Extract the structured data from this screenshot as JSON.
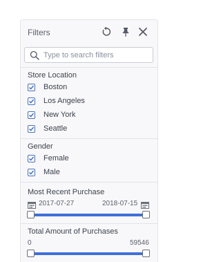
{
  "panel": {
    "title": "Filters",
    "reset_icon": "reset-icon",
    "pin_icon": "pin-icon",
    "close_icon": "close-icon"
  },
  "search": {
    "placeholder": "Type to search filters",
    "value": "",
    "icon": "search-icon"
  },
  "store_location": {
    "title": "Store Location",
    "items": [
      {
        "label": "Boston",
        "checked": true
      },
      {
        "label": "Los Angeles",
        "checked": true
      },
      {
        "label": "New York",
        "checked": true
      },
      {
        "label": "Seattle",
        "checked": true
      }
    ]
  },
  "gender": {
    "title": "Gender",
    "items": [
      {
        "label": "Female",
        "checked": true
      },
      {
        "label": "Male",
        "checked": true
      }
    ]
  },
  "most_recent_purchase": {
    "title": "Most Recent Purchase",
    "start": "2017-07-27",
    "end": "2018-07-15",
    "icon": "calendar-icon"
  },
  "total_amount": {
    "title": "Total Amount of Purchases",
    "min": "0",
    "max": "59546"
  },
  "colors": {
    "accent": "#3f6fd8",
    "checkbox_border": "#4a6fb5",
    "panel_bg": "#f8f8fa"
  }
}
